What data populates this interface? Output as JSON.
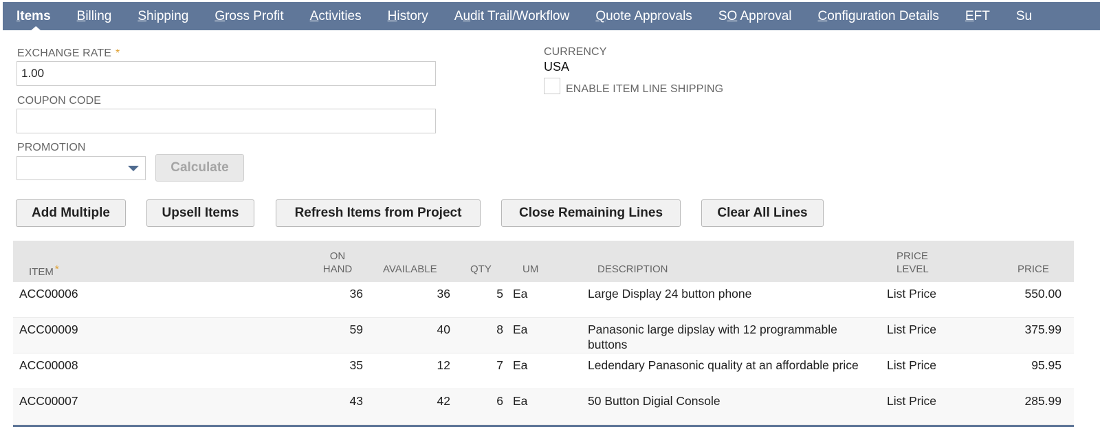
{
  "tabs": [
    {
      "label": "Items",
      "accesskey_index": 0,
      "active": true
    },
    {
      "label": "Billing",
      "accesskey_index": 0,
      "active": false
    },
    {
      "label": "Shipping",
      "accesskey_index": 0,
      "active": false
    },
    {
      "label": "Gross Profit",
      "accesskey_index": 0,
      "active": false
    },
    {
      "label": "Activities",
      "accesskey_index": 0,
      "active": false
    },
    {
      "label": "History",
      "accesskey_index": 0,
      "active": false
    },
    {
      "label": "Audit Trail/Workflow",
      "accesskey_index": 1,
      "active": false
    },
    {
      "label": "Quote Approvals",
      "accesskey_index": 0,
      "active": false
    },
    {
      "label": "SO Approval",
      "accesskey_index": 1,
      "active": false
    },
    {
      "label": "Configuration Details",
      "accesskey_index": 0,
      "active": false
    },
    {
      "label": "EFT",
      "accesskey_index": 0,
      "active": false
    },
    {
      "label": "Su",
      "accesskey_index": -1,
      "active": false
    }
  ],
  "form": {
    "exchange_rate": {
      "label": "EXCHANGE RATE",
      "required_mark": "*",
      "value": "1.00"
    },
    "coupon_code": {
      "label": "COUPON CODE",
      "value": ""
    },
    "promotion": {
      "label": "PROMOTION",
      "selected": ""
    },
    "calculate_label": "Calculate",
    "currency": {
      "label": "CURRENCY",
      "value": "USA"
    },
    "enable_item_line_shipping": {
      "label": "ENABLE ITEM LINE SHIPPING",
      "checked": false
    }
  },
  "actions": {
    "add_multiple": "Add Multiple",
    "upsell_items": "Upsell Items",
    "refresh_items": "Refresh Items from Project",
    "close_remaining": "Close Remaining Lines",
    "clear_all": "Clear All Lines"
  },
  "table": {
    "headers": {
      "item": "ITEM",
      "item_required": "*",
      "on_hand_1": "ON",
      "on_hand_2": "HAND",
      "available": "AVAILABLE",
      "qty": "QTY",
      "um": "UM",
      "description": "DESCRIPTION",
      "price_level_1": "PRICE",
      "price_level_2": "LEVEL",
      "price": "PRICE"
    },
    "rows": [
      {
        "item": "ACC00006",
        "on_hand": "36",
        "available": "36",
        "qty": "5",
        "um": "Ea",
        "description": "Large Display 24 button phone",
        "price_level": "List Price",
        "price": "550.00"
      },
      {
        "item": "ACC00009",
        "on_hand": "59",
        "available": "40",
        "qty": "8",
        "um": "Ea",
        "description": "Panasonic large dipslay with 12 programmable buttons",
        "price_level": "List Price",
        "price": "375.99"
      },
      {
        "item": "ACC00008",
        "on_hand": "35",
        "available": "12",
        "qty": "7",
        "um": "Ea",
        "description": "Ledendary Panasonic quality at an affordable price",
        "price_level": "List Price",
        "price": "95.95"
      },
      {
        "item": "ACC00007",
        "on_hand": "43",
        "available": "42",
        "qty": "6",
        "um": "Ea",
        "description": "50 Button Digial Console",
        "price_level": "List Price",
        "price": "285.99"
      }
    ]
  },
  "colors": {
    "tabbar": "#607799",
    "required": "#e0a030",
    "dropdown_arrow": "#4f6b8f"
  }
}
